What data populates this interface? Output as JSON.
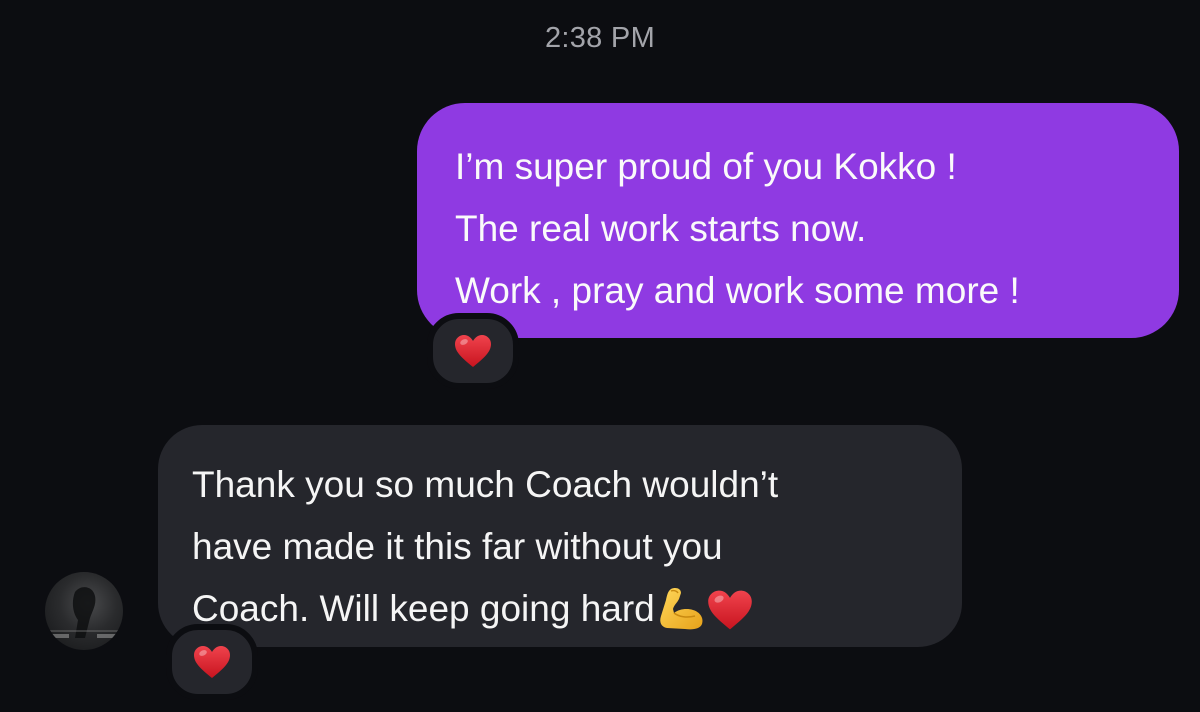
{
  "timestamp": "2:38 PM",
  "messages": [
    {
      "direction": "sent",
      "text": "I’m super proud of you Kokko !\nThe real work starts now.\nWork , pray and work some more !",
      "reaction": "heart-icon"
    },
    {
      "direction": "received",
      "text": "Thank you so much Coach wouldn’t\nhave made it this far without you\nCoach. Will keep going hard",
      "trailing_emoji": [
        "flexed-biceps-icon",
        "heart-icon"
      ],
      "reaction": "heart-icon"
    }
  ],
  "colors": {
    "background": "#0c0d11",
    "sent_bubble": "#8f3ae2",
    "received_bubble": "#25262c",
    "timestamp": "#a3a4aa",
    "heart": "#e0202f"
  }
}
